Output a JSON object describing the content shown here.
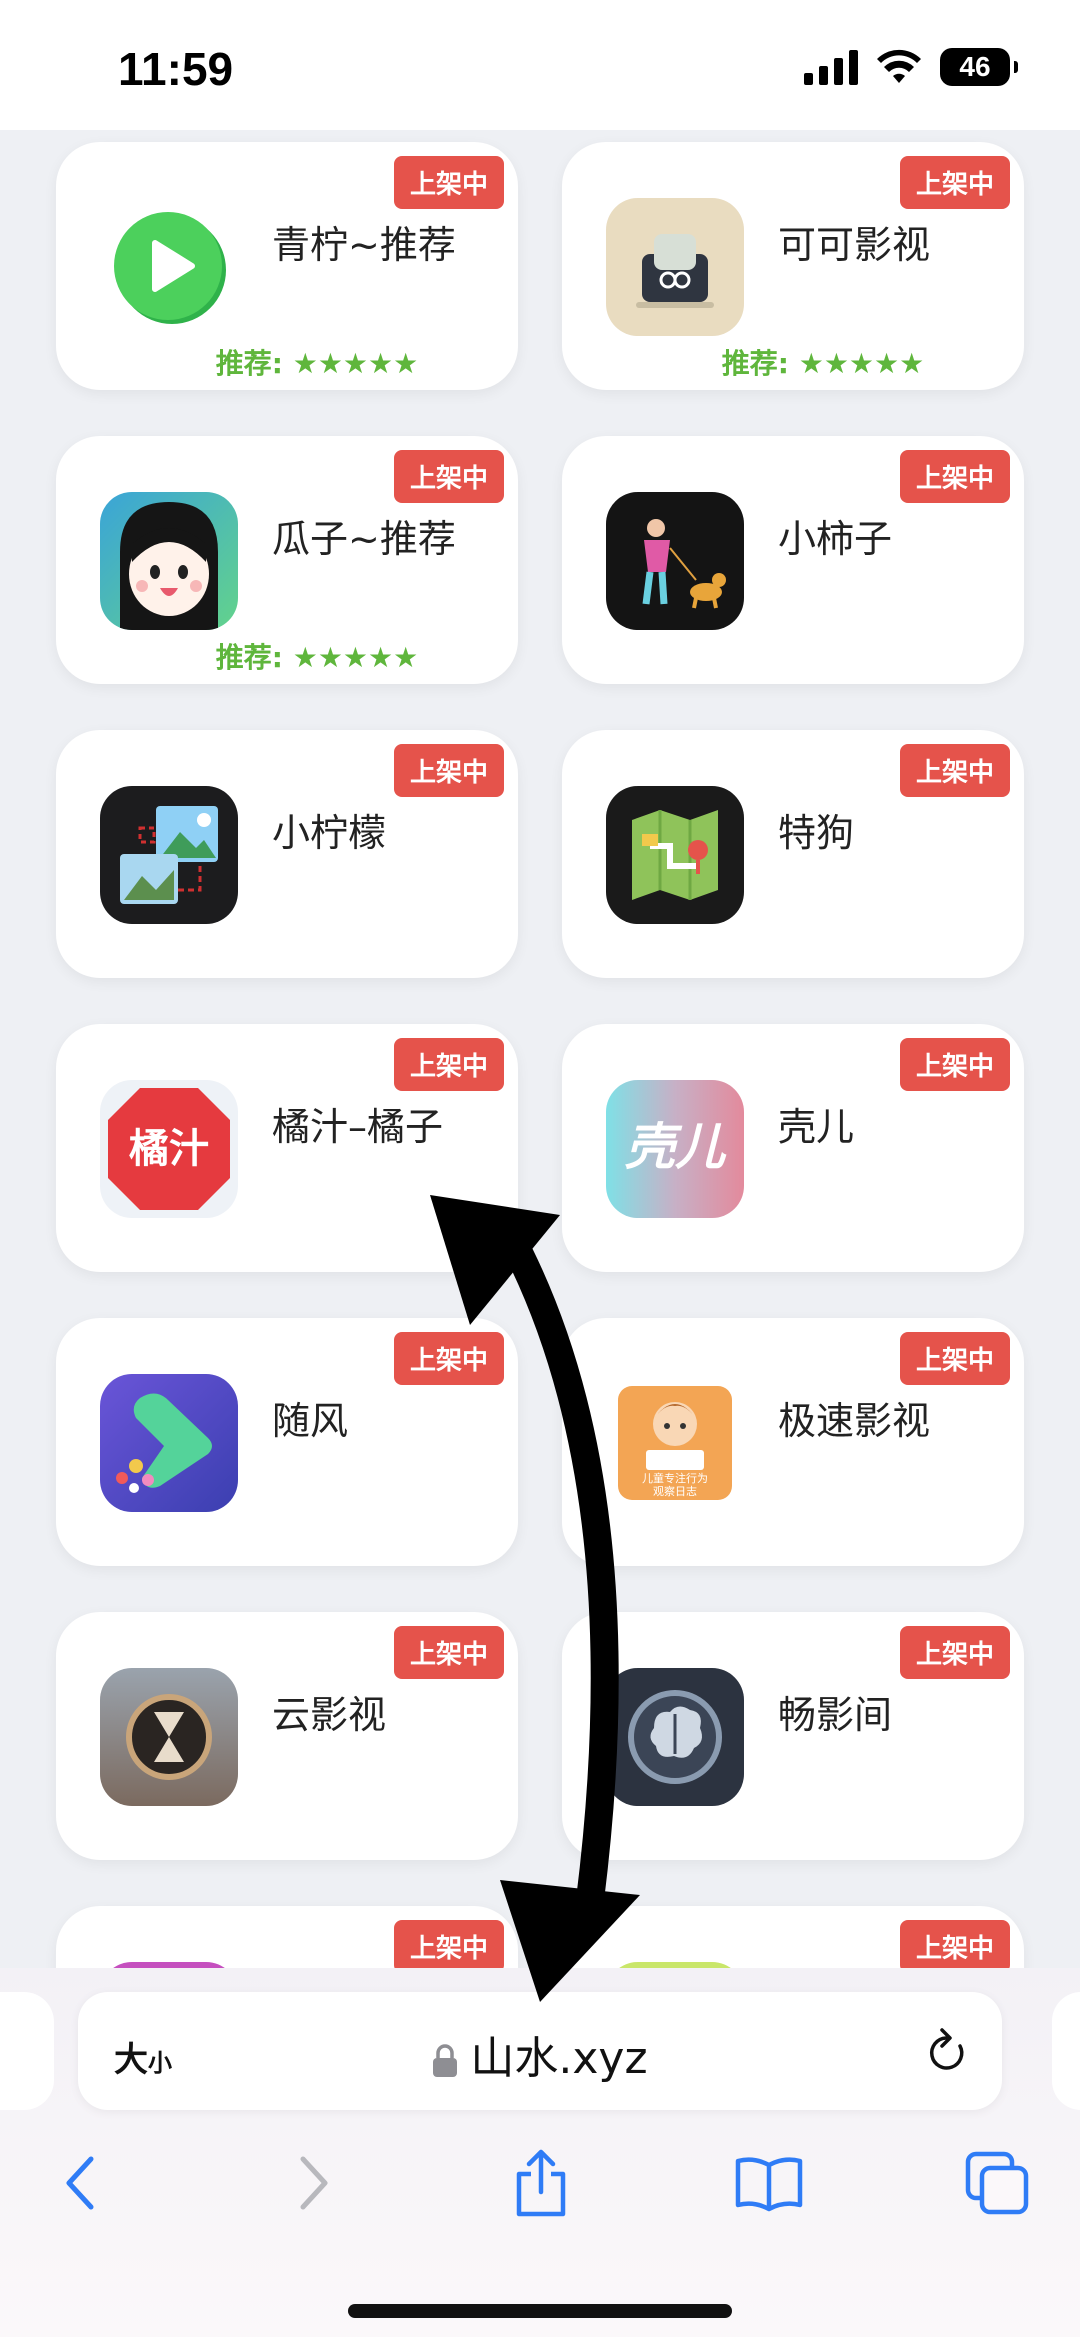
{
  "status_bar": {
    "time": "11:59",
    "battery": "46"
  },
  "badge_text": "上架中",
  "apps": [
    {
      "name": "青柠~推荐",
      "rating": "推荐: ★★★★★",
      "icon": "green-play-icon"
    },
    {
      "name": "可可影视",
      "rating": "推荐: ★★★★★",
      "icon": "tv-icon"
    },
    {
      "name": "瓜子~推荐",
      "rating": "推荐: ★★★★★",
      "icon": "cartoon-face-icon"
    },
    {
      "name": "小柿子",
      "rating": "",
      "icon": "girl-dog-icon"
    },
    {
      "name": "小柠檬",
      "rating": "",
      "icon": "photos-icon"
    },
    {
      "name": "特狗",
      "rating": "",
      "icon": "map-icon"
    },
    {
      "name": "橘汁–橘子",
      "rating": "",
      "icon": "juzhi-icon",
      "icon_text": "橘汁"
    },
    {
      "name": "壳儿",
      "rating": "",
      "icon": "keer-icon",
      "icon_text": "壳儿"
    },
    {
      "name": "随风",
      "rating": "",
      "icon": "play-arrow-icon"
    },
    {
      "name": "极速影视",
      "rating": "",
      "icon": "kid-reading-icon",
      "icon_text": "儿童专注行为\n观察日志"
    },
    {
      "name": "云影视",
      "rating": "",
      "icon": "hourglass-icon"
    },
    {
      "name": "畅影间",
      "rating": "",
      "icon": "brain-icon"
    }
  ],
  "browser": {
    "text_size_label": "大",
    "text_size_small": "小",
    "url": "山水.xyz"
  },
  "colors": {
    "badge": "#e5534b",
    "rating": "#5fb63c",
    "accent": "#2f7cf6"
  }
}
